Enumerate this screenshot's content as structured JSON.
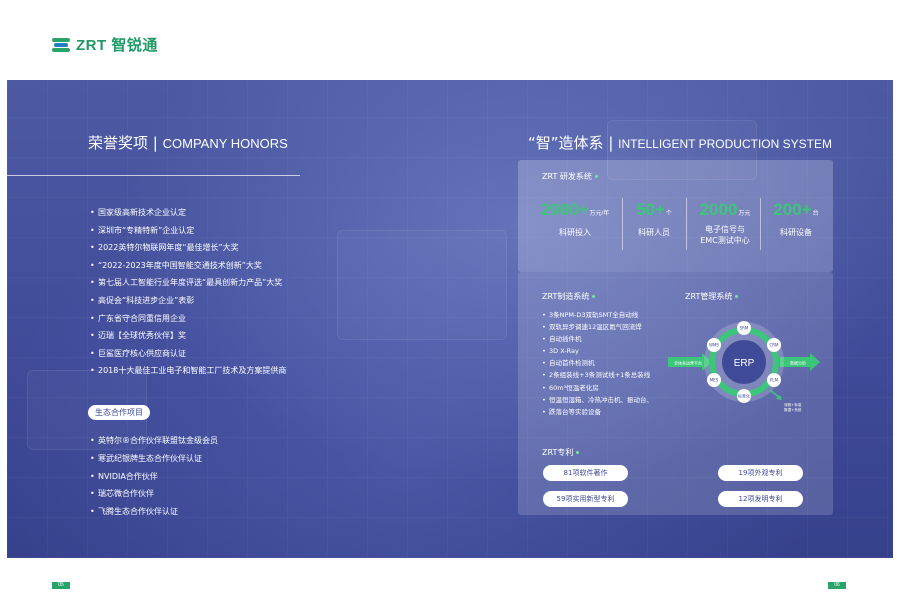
{
  "logo": {
    "text": "ZRT 智锐通"
  },
  "honors": {
    "title_cn": "荣誉奖项",
    "title_sep": " | ",
    "title_en": "COMPANY HONORS",
    "items": [
      "国家级高新技术企业认定",
      "深圳市“专精特新”企业认定",
      "2022英特尔物联网年度“最佳增长”大奖",
      "“2022-2023年度中国智能交通技术创新”大奖",
      "第七届人工智能行业年度评选“最具创新力产品”大奖",
      "高促会“科技进步企业”表彰",
      "广东省守合同重信用企业",
      "迈瑞【全球优秀伙伴】奖",
      "巨鲨医疗核心供应商认证",
      "2018十大最佳工业电子和智能工厂技术及方案提供商"
    ]
  },
  "eco": {
    "tag": "生态合作项目",
    "items": [
      "英特尔®合作伙伴联盟钛金级会员",
      "寒武纪银牌生态合作伙伴认证",
      "NVIDIA合作伙伴",
      "瑞芯微合作伙伴",
      "飞腾生态合作伙伴认证"
    ]
  },
  "production": {
    "title_cn": "“智”造体系",
    "title_sep": " | ",
    "title_en": "INTELLIGENT PRODUCTION SYSTEM",
    "rd": {
      "label": "ZRT 研发系统",
      "stats": [
        {
          "value": "2000+",
          "unit": "万元/年",
          "label": "科研投入"
        },
        {
          "value": "50+",
          "unit": "个",
          "label": "科研人员"
        },
        {
          "value": "2000",
          "unit": "万元",
          "label": "电子信号与",
          "label2": "EMC测试中心"
        },
        {
          "value": "200+",
          "unit": "台",
          "label": "科研设备"
        }
      ]
    },
    "mfg": {
      "label": "ZRT制造系统",
      "items": [
        "3条NPM-D3双轨SMT全自动线",
        "双轨异步调速12温区氮气回流焊",
        "自动插件机",
        "3D X-Ray",
        "自动首件检测机",
        "2条组装线+3条测试线+1条总装线",
        "60m³恒温老化房",
        "恒温恒湿箱、冷热冲击机、振动台、",
        "跌落台等实验设备"
      ]
    },
    "mgmt": {
      "label": "ZRT管理系统",
      "center": "ERP",
      "nodes": [
        "SRM",
        "CRM",
        "PLM",
        "标准化",
        "MES",
        "WMS"
      ],
      "left_arrow": "全体系运营平台",
      "right_arrow": "数据分析",
      "note_line1": "流程+标准",
      "note_line2": "数据+系统"
    },
    "patents": {
      "label": "ZRT专利",
      "items": [
        "81项软件著作",
        "19项外观专利",
        "59项实用新型专利",
        "12项发明专利"
      ]
    }
  },
  "pages": {
    "left": "05",
    "right": "06"
  },
  "colors": {
    "accent_green": "#3cc67a",
    "banner": "#4d5aa3",
    "logo_green": "#1f9a66"
  }
}
